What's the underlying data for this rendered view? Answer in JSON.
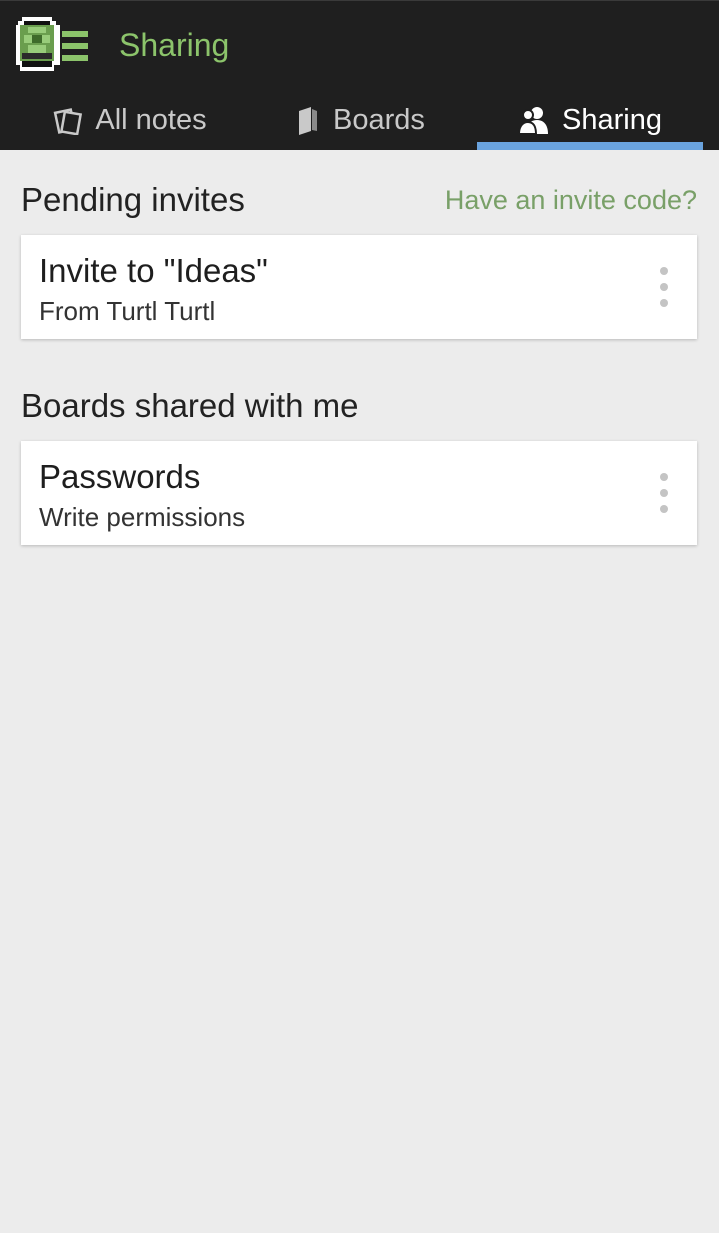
{
  "app": {
    "title": "Sharing",
    "logo": "turtl-logo"
  },
  "tabs": [
    {
      "label": "All notes",
      "icon": "notes-icon"
    },
    {
      "label": "Boards",
      "icon": "boards-icon"
    },
    {
      "label": "Sharing",
      "icon": "sharing-icon",
      "active": true
    }
  ],
  "pending": {
    "title": "Pending invites",
    "invite_code_link": "Have an invite code?",
    "items": [
      {
        "title": "Invite to \"Ideas\"",
        "subtitle": "From Turtl Turtl"
      }
    ]
  },
  "shared": {
    "title": "Boards shared with me",
    "items": [
      {
        "title": "Passwords",
        "subtitle": "Write permissions"
      }
    ]
  },
  "colors": {
    "header_bg": "#1f1f1f",
    "accent_green": "#8cc46b",
    "tab_underline": "#6aa3de",
    "page_bg": "#ececec"
  }
}
